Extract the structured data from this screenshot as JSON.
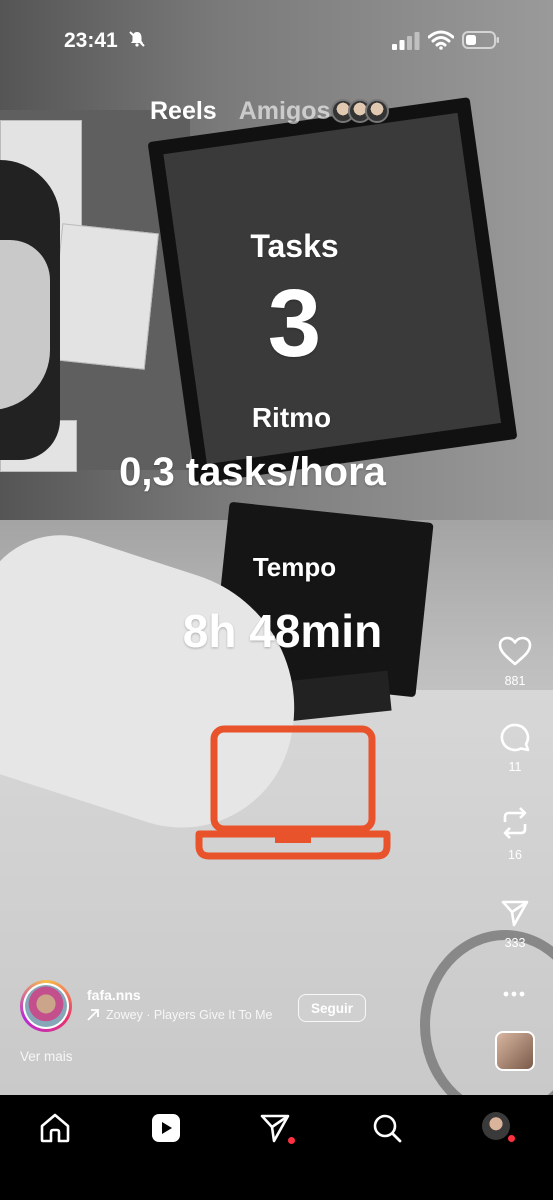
{
  "status_bar": {
    "time": "23:41"
  },
  "tabs": {
    "reels": "Reels",
    "friends": "Amigos"
  },
  "overlay": {
    "tasks_label": "Tasks",
    "tasks_value": "3",
    "rhythm_label": "Ritmo",
    "rhythm_value": "0,3 tasks/hora",
    "time_label": "Tempo",
    "time_value": "8h 48min",
    "icon_color": "#e8532b"
  },
  "actions": {
    "likes": "881",
    "comments": "11",
    "reposts": "16",
    "shares": "333"
  },
  "author": {
    "username": "fafa.nns",
    "song": "Zowey · Players Give It To Me",
    "follow_label": "Seguir",
    "see_more": "Ver mais"
  },
  "nav": {
    "items": [
      "home-icon",
      "reels-icon",
      "direct-messages-icon",
      "search-icon",
      "profile-avatar"
    ],
    "notification_color": "#ff3040"
  }
}
